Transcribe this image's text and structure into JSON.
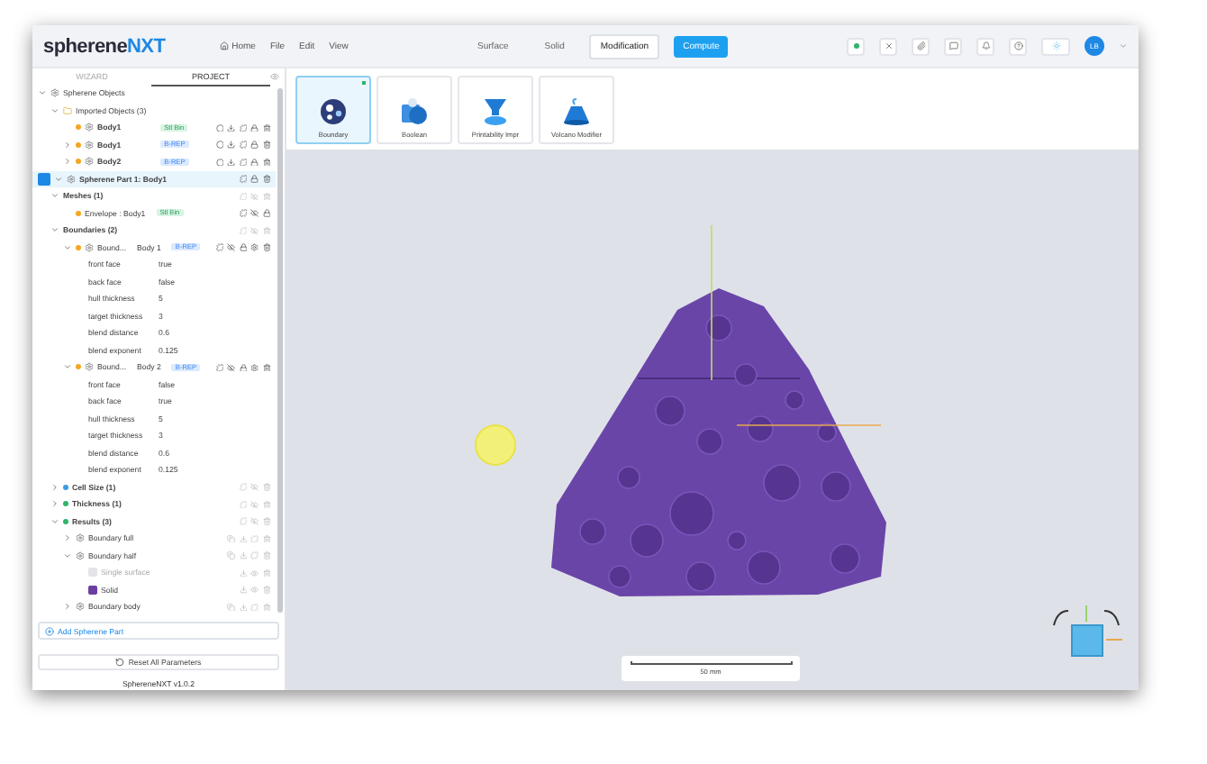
{
  "app": {
    "logo_main": "spherene",
    "logo_accent": "NXT",
    "menu": [
      "Home",
      "File",
      "Edit",
      "View"
    ],
    "mode_tabs": [
      {
        "label": "Surface",
        "selected": false
      },
      {
        "label": "Solid",
        "selected": false
      },
      {
        "label": "Modification",
        "selected": true
      }
    ],
    "compute_button": "Compute",
    "avatar": "LB"
  },
  "sidebar": {
    "tabs": [
      {
        "label": "WIZARD",
        "selected": false
      },
      {
        "label": "PROJECT",
        "selected": true
      }
    ],
    "tree": [
      {
        "kind": "group",
        "label": "Spherene Objects",
        "expanded": true,
        "selected": false,
        "children": [
          {
            "kind": "folder",
            "label": "Imported Objects",
            "count": "(3)",
            "expanded": true,
            "children": [
              {
                "kind": "body",
                "label": "Body1",
                "tag": {
                  "kind": "mesh",
                  "label": "Stl Bin"
                },
                "color": "#f5a623"
              },
              {
                "kind": "body",
                "label": "Body1",
                "tag": {
                  "kind": "brep",
                  "label": "B-REP"
                },
                "color": "#f5a623",
                "expanded": false
              },
              {
                "kind": "body",
                "label": "Body2",
                "tag": {
                  "kind": "brep",
                  "label": "B-REP"
                },
                "color": "#f5a623",
                "expanded": false
              }
            ]
          }
        ]
      },
      {
        "kind": "part",
        "label": "Spherene Part 1: Body1",
        "checked": true,
        "expanded": true,
        "selected": true,
        "children": [
          {
            "kind": "section",
            "label": "Meshes",
            "count": "(1)",
            "expanded": true,
            "children": [
              {
                "kind": "mesh",
                "label": "Envelope : Body1",
                "tag": {
                  "kind": "mesh",
                  "label": "Stl Bin"
                },
                "color": "#f5a623"
              }
            ]
          },
          {
            "kind": "section",
            "label": "Boundaries",
            "count": "(2)",
            "expanded": true,
            "children": [
              {
                "kind": "boundary",
                "label": "Bound...",
                "sub": "Body 1",
                "tag": {
                  "kind": "brep",
                  "label": "B-REP"
                },
                "color": "#f5a623",
                "expanded": true,
                "children": [
                  {
                    "kind": "prop",
                    "label": "front face",
                    "value": "true"
                  },
                  {
                    "kind": "prop",
                    "label": "back face",
                    "value": "false"
                  },
                  {
                    "kind": "prop",
                    "label": "hull thickness",
                    "value": "5"
                  },
                  {
                    "kind": "prop",
                    "label": "target thickness",
                    "value": "3"
                  },
                  {
                    "kind": "prop",
                    "label": "blend distance",
                    "value": "0.6"
                  },
                  {
                    "kind": "prop",
                    "label": "blend exponent",
                    "value": "0.125"
                  }
                ]
              },
              {
                "kind": "boundary",
                "label": "Bound...",
                "sub": "Body 2",
                "tag": {
                  "kind": "brep",
                  "label": "B-REP"
                },
                "color": "#f5a623",
                "expanded": true,
                "children": [
                  {
                    "kind": "prop",
                    "label": "front face",
                    "value": "false"
                  },
                  {
                    "kind": "prop",
                    "label": "back face",
                    "value": "true"
                  },
                  {
                    "kind": "prop",
                    "label": "hull thickness",
                    "value": "5"
                  },
                  {
                    "kind": "prop",
                    "label": "target thickness",
                    "value": "3"
                  },
                  {
                    "kind": "prop",
                    "label": "blend distance",
                    "value": "0.6"
                  },
                  {
                    "kind": "prop",
                    "label": "blend exponent",
                    "value": "0.125"
                  }
                ]
              }
            ]
          },
          {
            "kind": "section",
            "label": "Cell Size",
            "count": "(1)",
            "color": "#3b9be0",
            "expanded": false
          },
          {
            "kind": "section",
            "label": "Thickness",
            "count": "(1)",
            "color": "#2fb36b",
            "expanded": false
          },
          {
            "kind": "section",
            "label": "Results",
            "count": "(3)",
            "color": "#2fb36b",
            "expanded": true,
            "children": [
              {
                "kind": "result",
                "label": "Boundary full",
                "expanded": false
              },
              {
                "kind": "result",
                "label": "Boundary half",
                "expanded": true,
                "children": [
                  {
                    "kind": "variant",
                    "label": "Single surface",
                    "disabled": true
                  },
                  {
                    "kind": "variant",
                    "label": "Solid",
                    "disabled": false
                  }
                ]
              },
              {
                "kind": "result",
                "label": "Boundary body",
                "expanded": false
              }
            ]
          }
        ]
      }
    ],
    "add_link": "Add Spherene Part",
    "reset_button": "Reset All Parameters",
    "version": "SphereneNXT v1.0.2"
  },
  "tools": [
    {
      "label": "Boundary",
      "kind": "boundary",
      "selected": true
    },
    {
      "label": "Boolean",
      "kind": "boolean",
      "selected": false
    },
    {
      "label": "Printability Impr",
      "kind": "printability",
      "selected": false
    },
    {
      "label": "Volcano Modifier",
      "kind": "volcano",
      "selected": false
    }
  ],
  "viewport": {
    "scale_label": "50 mm"
  }
}
